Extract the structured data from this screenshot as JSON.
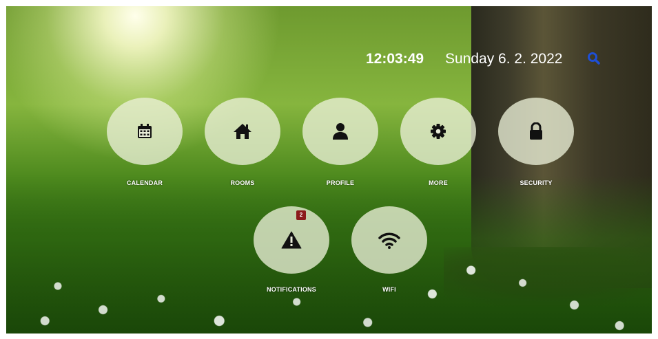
{
  "header": {
    "time": "12:03:49",
    "date": "Sunday 6. 2. 2022",
    "search_icon": "search-icon",
    "search_color": "#1e4fd6"
  },
  "tiles": [
    {
      "id": "calendar",
      "label": "CALENDAR",
      "icon": "calendar-icon"
    },
    {
      "id": "rooms",
      "label": "ROOMS",
      "icon": "home-icon"
    },
    {
      "id": "profile",
      "label": "PROFILE",
      "icon": "user-icon"
    },
    {
      "id": "more",
      "label": "MORE",
      "icon": "gear-icon"
    },
    {
      "id": "security",
      "label": "SECURITY",
      "icon": "lock-icon"
    },
    {
      "id": "notifications",
      "label": "NOTIFICATIONS",
      "icon": "warning-icon",
      "badge": "2"
    },
    {
      "id": "wifi",
      "label": "WIFI",
      "icon": "wifi-icon"
    }
  ],
  "colors": {
    "icon": "#111111",
    "badge": "#8b1a1a",
    "tile": "rgba(235,240,215,0.78)"
  }
}
